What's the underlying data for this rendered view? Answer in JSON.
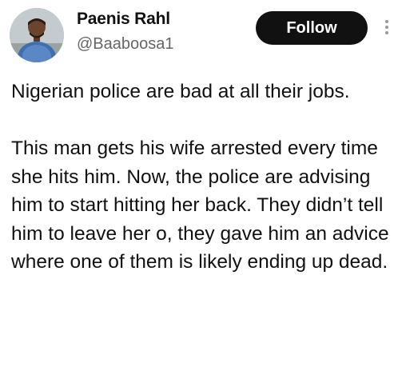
{
  "author": {
    "name": "Paenis Rahl",
    "handle": "@Baaboosa1",
    "avatar_icon": "profile-photo"
  },
  "actions": {
    "follow_label": "Follow",
    "more_icon": "vertical-ellipsis-icon"
  },
  "tweet": {
    "paragraph1": "Nigerian police are bad at all their jobs.",
    "paragraph2": "This man gets his wife arrested every time she hits him. Now, the police are advising him to start hitting her back. They didn’t tell him to leave her o, they gave him an advice where one of them is likely ending up dead."
  },
  "colors": {
    "follow_bg": "#111111",
    "follow_text": "#ffffff",
    "handle": "#666666",
    "text": "#111111"
  }
}
